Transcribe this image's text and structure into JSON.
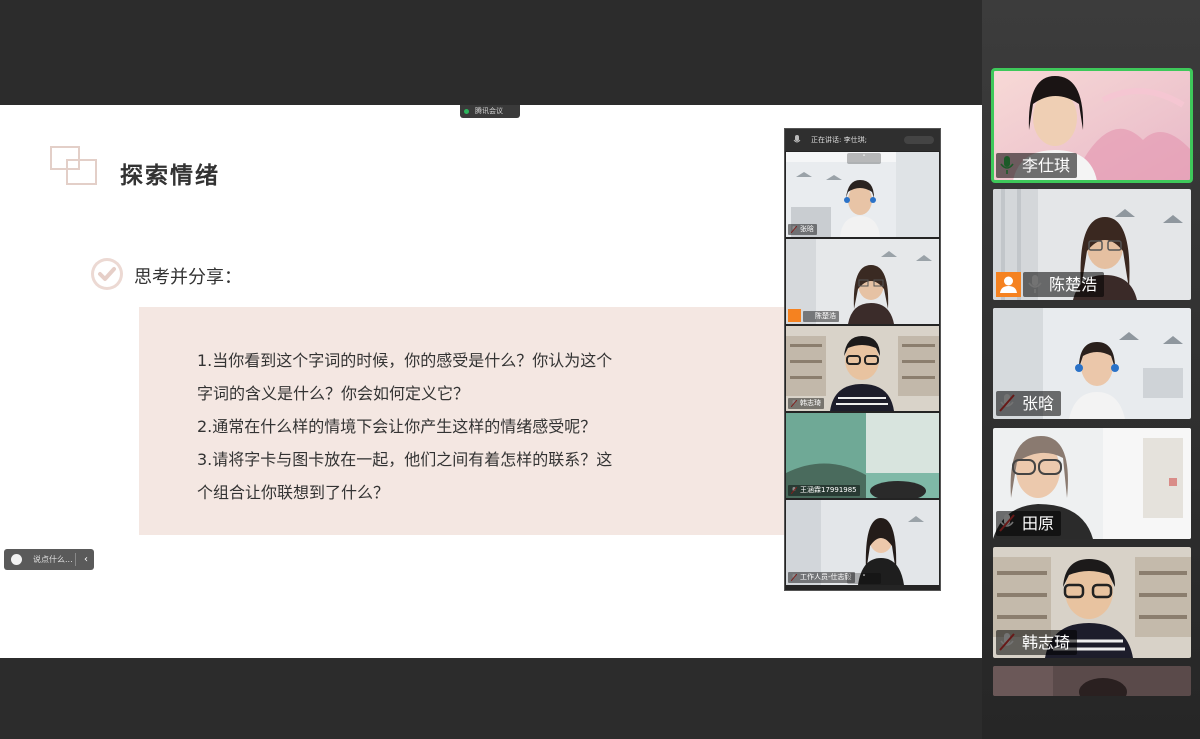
{
  "app": {
    "tag_label": "腾讯会议"
  },
  "slide": {
    "title": "探索情绪",
    "subtitle": "思考并分享：",
    "lines": [
      "1.当你看到这个字词的时候，你的感受是什么？你认为这个",
      "字词的含义是什么？你会如何定义它？",
      "2.通常在什么样的情境下会让你产生这样的情绪感受呢？",
      "3.请将字卡与图卡放在一起，他们之间有着怎样的联系？这",
      "个组合让你联想到了什么？"
    ]
  },
  "comment": {
    "placeholder": "说点什么...",
    "collapse": "‹"
  },
  "mini_gallery": {
    "header": "正在讲话: 李仕琪;",
    "tiles": [
      {
        "name": "张晗",
        "muted": true
      },
      {
        "name": "陈楚浩",
        "muted": false,
        "has_badge": true
      },
      {
        "name": "韩志琦",
        "muted": true
      },
      {
        "name": "王涵霖17991985",
        "muted": true
      },
      {
        "name": "工作人员-仕志毅",
        "muted": true
      }
    ],
    "scroll_up": "˄",
    "scroll_down": "˅"
  },
  "gallery": {
    "tiles": [
      {
        "name": "李仕琪",
        "muted": false,
        "active": true
      },
      {
        "name": "陈楚浩",
        "muted": false,
        "active": false,
        "has_badge": true
      },
      {
        "name": "张晗",
        "muted": true,
        "active": false
      },
      {
        "name": "田原",
        "muted": true,
        "active": false
      },
      {
        "name": "韩志琦",
        "muted": true,
        "active": false
      }
    ]
  },
  "colors": {
    "active_border": "#3ec85a",
    "accent_orange": "#f58220",
    "muted_red": "#e53935",
    "content_bg": "#f4e7e2"
  }
}
